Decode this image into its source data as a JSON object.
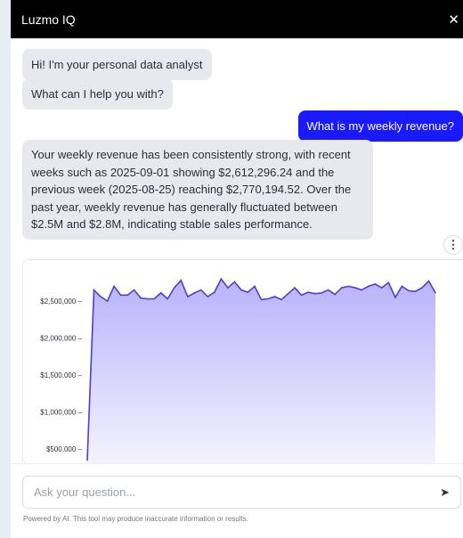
{
  "header": {
    "title": "Luzmo IQ",
    "close_icon": "close-icon"
  },
  "messages": {
    "greeting": "Hi! I'm your personal data analyst",
    "prompt": "What can I help you with?",
    "user_question": "What is my weekly revenue?",
    "answer": "Your weekly revenue has been consistently strong, with recent weeks such as 2025-09-01 showing $2,612,296.24 and the previous week (2025-08-25) reaching $2,770,194.52. Over the past year, weekly revenue has generally fluctuated between $2.5M and $2.8M, indicating stable sales performance."
  },
  "more_icon": "more-vertical-icon",
  "input": {
    "placeholder": "Ask your question...",
    "send_icon": "send-icon"
  },
  "disclaimer": "Powered by AI. This tool may produce inaccurate information or results.",
  "colors": {
    "header_bg": "#000000",
    "user_bubble": "#1a1aff",
    "bot_bubble": "#e7e9ef",
    "line": "#4b3fd6",
    "area_top": "#b9b3fb"
  },
  "chart_data": {
    "type": "area",
    "yticks": [
      "$2,500,000",
      "$2,000,000",
      "$1,500,000",
      "$1,000,000",
      "$500,000"
    ],
    "ytick_values": [
      2500000,
      2000000,
      1500000,
      1000000,
      500000
    ],
    "ylim": [
      300000,
      2900000
    ],
    "values": [
      350000,
      2650000,
      2560000,
      2500000,
      2700000,
      2580000,
      2580000,
      2650000,
      2540000,
      2530000,
      2530000,
      2610000,
      2530000,
      2680000,
      2780000,
      2560000,
      2610000,
      2650000,
      2560000,
      2620000,
      2800000,
      2680000,
      2760000,
      2650000,
      2620000,
      2700000,
      2520000,
      2530000,
      2560000,
      2520000,
      2600000,
      2680000,
      2580000,
      2620000,
      2600000,
      2610000,
      2650000,
      2590000,
      2680000,
      2700000,
      2680000,
      2650000,
      2700000,
      2730000,
      2680000,
      2750000,
      2550000,
      2700000,
      2640000,
      2630000,
      2680000,
      2770000,
      2612296
    ]
  }
}
